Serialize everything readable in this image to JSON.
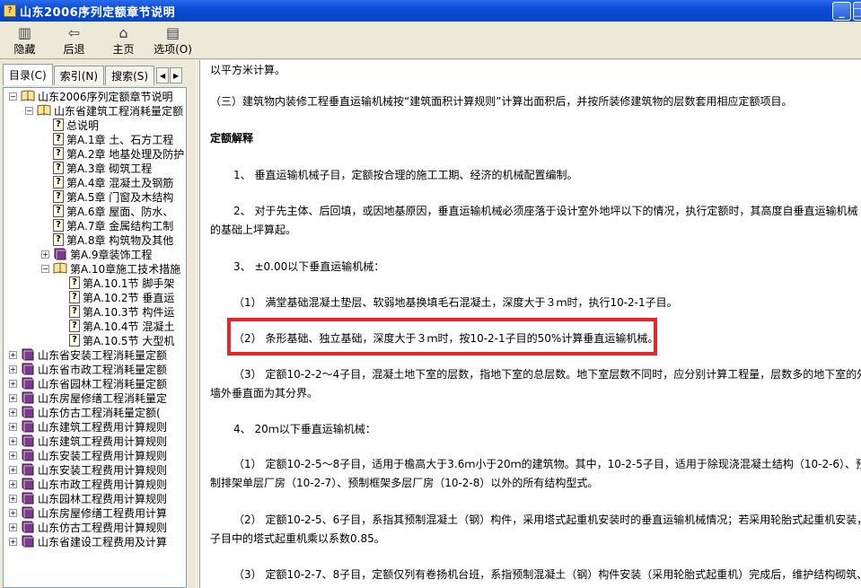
{
  "window": {
    "title": "山东2006序列定额章节说明",
    "minimize_glyph": "_",
    "maximize_glyph": "□"
  },
  "toolbar": {
    "buttons": [
      {
        "label": "隐藏",
        "icon": "hide-pane-icon",
        "glyph": "▥"
      },
      {
        "label": "后退",
        "icon": "back-arrow-icon",
        "glyph": "⇦"
      },
      {
        "label": "主页",
        "icon": "home-icon",
        "glyph": "⌂"
      },
      {
        "label": "选项(O)",
        "icon": "options-icon",
        "glyph": "▤"
      }
    ]
  },
  "sidebar": {
    "tabs": [
      {
        "label": "目录(C)",
        "active": true
      },
      {
        "label": "索引(N)",
        "active": false
      },
      {
        "label": "搜索(S)",
        "active": false
      }
    ],
    "tab_nav": {
      "left": "◀",
      "right": "▶"
    },
    "tree": [
      {
        "level": 0,
        "expander": "−",
        "icon": "book-open",
        "label": "山东2006序列定额章节说明"
      },
      {
        "level": 1,
        "expander": "−",
        "icon": "book-open",
        "label": "山东省建筑工程消耗量定额"
      },
      {
        "level": 2,
        "expander": "",
        "icon": "page",
        "label": "总说明"
      },
      {
        "level": 2,
        "expander": "",
        "icon": "page",
        "label": "第A.1章 土、石方工程"
      },
      {
        "level": 2,
        "expander": "",
        "icon": "page",
        "label": "第A.2章 地基处理及防护"
      },
      {
        "level": 2,
        "expander": "",
        "icon": "page",
        "label": "第A.3章 砌筑工程"
      },
      {
        "level": 2,
        "expander": "",
        "icon": "page",
        "label": "第A.4章 混凝土及钢筋"
      },
      {
        "level": 2,
        "expander": "",
        "icon": "page",
        "label": "第A.5章 门窗及木结构"
      },
      {
        "level": 2,
        "expander": "",
        "icon": "page",
        "label": "第A.6章 屋面、防水、"
      },
      {
        "level": 2,
        "expander": "",
        "icon": "page",
        "label": "第A.7章 金属结构工制"
      },
      {
        "level": 2,
        "expander": "",
        "icon": "page",
        "label": "第A.8章 构筑物及其他"
      },
      {
        "level": 2,
        "expander": "+",
        "icon": "book-closed",
        "label": "第A.9章装饰工程"
      },
      {
        "level": 2,
        "expander": "−",
        "icon": "book-open",
        "label": "第A.10章施工技术措施"
      },
      {
        "level": 3,
        "expander": "",
        "icon": "page",
        "label": "第A.10.1节 脚手架"
      },
      {
        "level": 3,
        "expander": "",
        "icon": "page",
        "label": "第A.10.2节 垂直运",
        "selected": true
      },
      {
        "level": 3,
        "expander": "",
        "icon": "page",
        "label": "第A.10.3节 构件运"
      },
      {
        "level": 3,
        "expander": "",
        "icon": "page",
        "label": "第A.10.4节 混凝土"
      },
      {
        "level": 3,
        "expander": "",
        "icon": "page",
        "label": "第A.10.5节 大型机"
      },
      {
        "level": 0,
        "expander": "+",
        "icon": "book-closed",
        "label": "山东省安装工程消耗量定额"
      },
      {
        "level": 0,
        "expander": "+",
        "icon": "book-closed",
        "label": "山东省市政工程消耗量定额"
      },
      {
        "level": 0,
        "expander": "+",
        "icon": "book-closed",
        "label": "山东省园林工程消耗量定额"
      },
      {
        "level": 0,
        "expander": "+",
        "icon": "book-closed",
        "label": "山东房屋修缮工程消耗量定"
      },
      {
        "level": 0,
        "expander": "+",
        "icon": "book-closed",
        "label": "山东仿古工程消耗量定额("
      },
      {
        "level": 0,
        "expander": "+",
        "icon": "book-closed",
        "label": "山东建筑工程费用计算规则"
      },
      {
        "level": 0,
        "expander": "+",
        "icon": "book-closed",
        "label": "山东建筑工程费用计算规则"
      },
      {
        "level": 0,
        "expander": "+",
        "icon": "book-closed",
        "label": "山东安装工程费用计算规则"
      },
      {
        "level": 0,
        "expander": "+",
        "icon": "book-closed",
        "label": "山东安装工程费用计算规则"
      },
      {
        "level": 0,
        "expander": "+",
        "icon": "book-closed",
        "label": "山东市政工程费用计算规则"
      },
      {
        "level": 0,
        "expander": "+",
        "icon": "book-closed",
        "label": "山东园林工程费用计算规则"
      },
      {
        "level": 0,
        "expander": "+",
        "icon": "book-closed",
        "label": "山东房屋修缮工程费用计算"
      },
      {
        "level": 0,
        "expander": "+",
        "icon": "book-closed",
        "label": "山东仿古工程费用计算规则"
      },
      {
        "level": 0,
        "expander": "+",
        "icon": "book-closed",
        "label": "山东省建设工程费用及计算"
      }
    ]
  },
  "content": {
    "paragraphs": [
      {
        "text": "以平方米计算。",
        "bold": false
      },
      {
        "text": "（三）建筑物内装修工程垂直运输机械按“建筑面积计算规则”计算出面积后，并按所装修建筑物的层数套用相应定额项目。",
        "bold": false
      },
      {
        "text": "定额解释",
        "bold": true
      },
      {
        "text": "1、 垂直运输机械子目，定额按合理的施工工期、经济的机械配置编制。",
        "bold": false
      },
      {
        "text": "2、 对于先主体、后回填，或因地基原因，垂直运输机械必须座落于设计室外地坪以下的情况，执行定额时，其高度自垂直运输机械",
        "bold": false
      },
      {
        "text": "的基础上坪算起。",
        "bold": false
      },
      {
        "text": "3、 ±0.00以下垂直运输机械：",
        "bold": false
      },
      {
        "text": "（1） 满堂基础混凝土垫层、软弱地基换填毛石混凝土，深度大于３ｍ时，执行10-2-1子目。",
        "bold": false
      },
      {
        "text": "（2） 条形基础、独立基础，深度大于３ｍ时，按10-2-1子目的50%计算垂直运输机械。",
        "bold": false
      },
      {
        "text": "（3） 定额10-2-2～4子目，混凝土地下室的层数，指地下室的总层数。地下室层数不同时，应分别计算工程量，层数多的地下室的外",
        "bold": false
      },
      {
        "text": "墙外垂直面为其分界。",
        "bold": false
      },
      {
        "text": "4、 20ｍ以下垂直运输机械：",
        "bold": false
      },
      {
        "text": "（1） 定额10-2-5～8子目，适用于檐高大于3.6ｍ小于20ｍ的建筑物。其中，10-2-5子目，适用于除现浇混凝土结构（10-2-6）、预",
        "bold": false
      },
      {
        "text": "制排架单层厂房（10-2-7）、预制框架多层厂房（10-2-8）以外的所有结构型式。",
        "bold": false
      },
      {
        "text": "（2） 定额10-2-5、6子目，系指其预制混凝土（钢）构件，采用塔式起重机安装时的垂直运输机械情况；若采用轮胎式起重机安装，",
        "bold": false
      },
      {
        "text": "子目中的塔式起重机乘以系数0.85。",
        "bold": false
      },
      {
        "text": "（3） 定额10-2-7、8子目，定额仅列有卷扬机台班，系指预制混凝土（钢）构件安装（采用轮胎式起重机）完成后，维护结构砌筑、",
        "bold": false
      }
    ],
    "highlight_color": "#e8252b"
  }
}
